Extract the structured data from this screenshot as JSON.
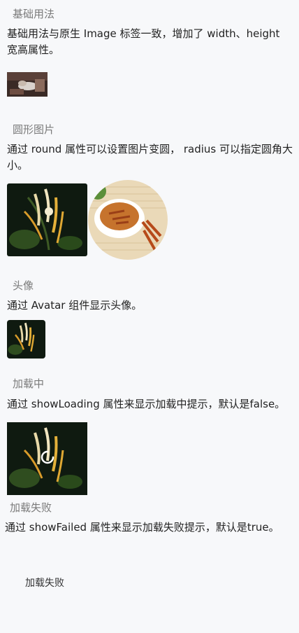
{
  "sections": {
    "basic": {
      "title": "基础用法",
      "description": "基础用法与原生 Image 标签一致，增加了 width、height 宽高属性。"
    },
    "round": {
      "title": "圆形图片",
      "description": "通过 round 属性可以设置图片变圆， radius 可以指定圆角大小。"
    },
    "avatar": {
      "title": "头像",
      "description": "通过 Avatar 组件显示头像。"
    },
    "loading": {
      "title": "加载中",
      "description": "通过 showLoading 属性来显示加载中提示，默认是false。"
    },
    "failed": {
      "title": "加载失败",
      "description": "通过 showFailed 属性来显示加载失败提示，默认是true。",
      "failed_text": "加载失败"
    }
  },
  "colors": {
    "page_background": "#f7f8fa",
    "title": "#7a7a7a",
    "text": "#222222"
  }
}
